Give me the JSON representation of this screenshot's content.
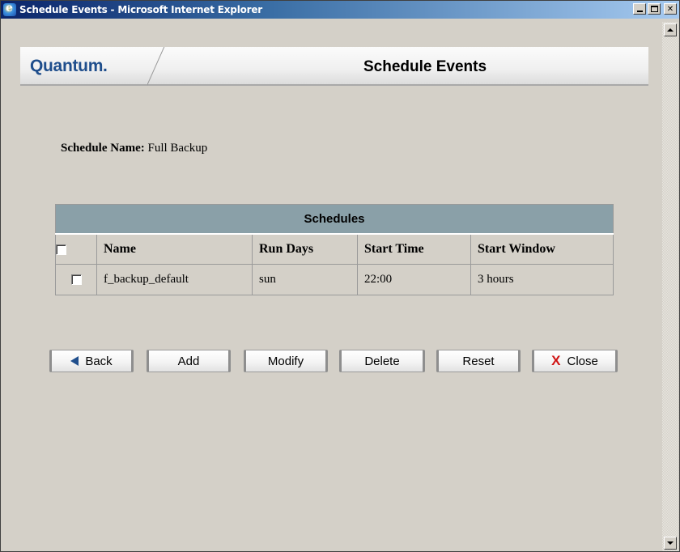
{
  "window": {
    "title": "Schedule Events - Microsoft Internet Explorer",
    "icon": "ie-icon",
    "controls": [
      "minimize-icon",
      "maximize-icon",
      "close-icon"
    ]
  },
  "header": {
    "logo": "Quantum.",
    "title": "Schedule Events"
  },
  "schedule": {
    "label": "Schedule Name:",
    "value": "Full Backup"
  },
  "table": {
    "caption": "Schedules",
    "columns": [
      "Name",
      "Run Days",
      "Start Time",
      "Start Window"
    ],
    "rows": [
      {
        "checked": false,
        "cells": [
          "f_backup_default",
          "sun",
          "22:00",
          "3 hours"
        ]
      }
    ]
  },
  "buttons": {
    "back": "Back",
    "add": "Add",
    "modify": "Modify",
    "delete": "Delete",
    "reset": "Reset",
    "close": "Close"
  },
  "colors": {
    "title_bar": "#0a246a",
    "table_caption": "#8aa0a8",
    "logo": "#1f4e8c",
    "close_x": "#d01414"
  }
}
